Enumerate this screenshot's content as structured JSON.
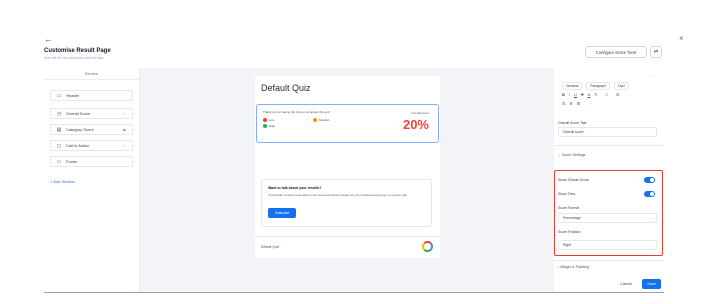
{
  "header": {
    "back_icon": "←",
    "close_icon": "×",
    "title": "Customise Result Page",
    "subtitle": "User will see this when they finish the quiz",
    "configure_button": "Configure Score Tiers",
    "swap_icon": "⇄"
  },
  "sections": {
    "heading": "Section",
    "items": [
      {
        "icon": "▭",
        "label": "Header",
        "action": ""
      },
      {
        "icon": "◷",
        "label": "Overall Score",
        "action": "⇔"
      },
      {
        "icon": "▤",
        "label": "Category Score",
        "action": "⇆"
      },
      {
        "icon": "◻",
        "label": "Call to Action",
        "action": "⇔"
      },
      {
        "icon": "▭",
        "label": "Footer",
        "action": ""
      }
    ],
    "add_label": "+ Add Section"
  },
  "preview": {
    "quiz_title": "Default Quiz",
    "thanks_text": "Thank you for taking the time to complete this quiz",
    "tiers": [
      {
        "label": "Low",
        "color": "#f04438"
      },
      {
        "label": "Medium",
        "color": "#f79009"
      },
      {
        "label": "High",
        "color": "#12b76a"
      }
    ],
    "overall_label": "Overall score",
    "overall_value": "20%",
    "cta_title": "Want to talk about your results?",
    "cta_text": "If you'd like to learn more about your score and what it means for your business lets jump on a zoom call.",
    "cta_button": "Subscribe",
    "footer_text": "Default Quiz",
    "footer_logo": "google-logo"
  },
  "settings": {
    "editor": {
      "font_select": "Verdana",
      "style_select": "Paragraph",
      "size_select": "14px",
      "format_icons": [
        "B",
        "I",
        "U",
        "S",
        "A",
        "✎",
        "≡",
        "☰"
      ],
      "insert_icons": [
        "⊡",
        "⊕",
        "⊞",
        "⋮"
      ]
    },
    "score_title_label": "Overall Score Title",
    "score_title_value": "Overall score",
    "score_settings_label": "Score Settings",
    "show_overall_label": "Show Overall Score",
    "show_overall_on": true,
    "show_tiers_label": "Show Tiers",
    "show_tiers_on": true,
    "score_format_label": "Score Format",
    "score_format_value": "Percentage",
    "score_position_label": "Score Position",
    "score_position_value": "Right",
    "margin_label": "Margin & Padding",
    "highlight_color": "#e2412f"
  },
  "footer": {
    "cancel": "Cancel",
    "save": "Save"
  },
  "colors": {
    "accent": "#1570ef"
  }
}
